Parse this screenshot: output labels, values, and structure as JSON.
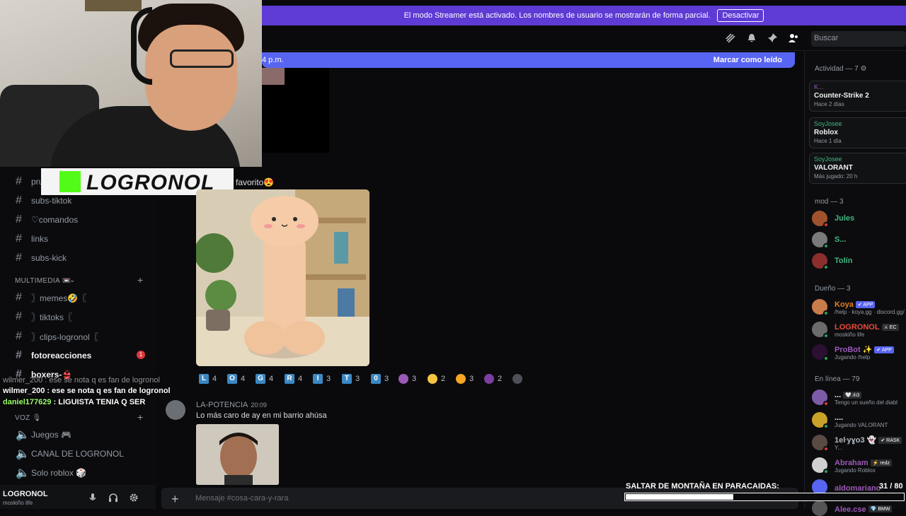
{
  "streamer_banner": {
    "message": "El modo Streamer está activado. Los nombres de usuario se mostrarán de forma parcial.",
    "button": "Desactivar"
  },
  "header": {
    "search_placeholder": "Buscar"
  },
  "new_messages_bar": {
    "time": "4 p.m.",
    "mark_read": "Marcar como leído"
  },
  "overlay_logo": {
    "text": "LOGRONOL",
    "color": "#53fc18"
  },
  "sidebar": {
    "channels_top": [
      {
        "label": "pru"
      },
      {
        "label": "subs-tiktok"
      },
      {
        "label": "♡comandos"
      },
      {
        "label": "links"
      },
      {
        "label": "subs-kick"
      }
    ],
    "category_multimedia": "MULTIMEDIA 📼",
    "multimedia_channels": [
      {
        "label": "〗memes🤣〖"
      },
      {
        "label": "〗tiktoks〖"
      },
      {
        "label": "〗clips-logronol〖"
      },
      {
        "label": "fotoreacciones",
        "badge": "1"
      },
      {
        "label": "boxers-👙"
      }
    ],
    "category_voice": "VOZ 🎙",
    "voice_channels": [
      {
        "label": "Juegos 🎮"
      },
      {
        "label": "CANAL DE LOGRONOL"
      },
      {
        "label": "Solo roblox 🎲"
      }
    ]
  },
  "chat_overlay": [
    {
      "user": "wilmer_200",
      "text": "ese se nota q es fan de logronol",
      "user_color": "#ffffff"
    },
    {
      "user": "daniel177629",
      "text": "LIGUISTA TENIA Q SER",
      "user_color": "#9bff6a"
    }
  ],
  "user_panel": {
    "name": "LOGRONOL",
    "status": "moskiño life"
  },
  "messages": {
    "first_text": "favorito😍",
    "reactions": [
      {
        "type": "tile",
        "label": "L",
        "count": "4"
      },
      {
        "type": "tile",
        "label": "O",
        "count": "4"
      },
      {
        "type": "tile",
        "label": "G",
        "count": "4"
      },
      {
        "type": "tile",
        "label": "R",
        "count": "4"
      },
      {
        "type": "tile",
        "label": "I",
        "count": "3"
      },
      {
        "type": "tile",
        "label": "T",
        "count": "3"
      },
      {
        "type": "tile",
        "label": "0",
        "count": "3"
      },
      {
        "type": "emoji",
        "icon": "imp-face",
        "color": "#9b59b6",
        "count": "3"
      },
      {
        "type": "emoji",
        "icon": "clap",
        "color": "#f5c542",
        "count": "2"
      },
      {
        "type": "emoji",
        "icon": "heart-eyes",
        "color": "#f5a623",
        "count": "3"
      },
      {
        "type": "emoji",
        "icon": "eggplant",
        "color": "#7b3fa0",
        "count": "2"
      }
    ],
    "second": {
      "author": "LA-POTENCIA",
      "timestamp": "20:09",
      "text": "Lo más caro de ay en mi barrio ahúsa"
    }
  },
  "composer": {
    "placeholder": "Mensaje #cosa-cara-y-rara"
  },
  "stream_goal": {
    "label": "SALTAR DE MONTAÑA EN PARACAIDAS:",
    "count": "31 / 80",
    "progress": 0.3875
  },
  "members": {
    "activity_header": "Actividad — 7 ⚙",
    "activities": [
      {
        "user": "K...",
        "game": "Counter-Strike 2",
        "since": "Hace 2 días"
      },
      {
        "user": "SoyJosee",
        "game": "Roblox",
        "since": "Hace 1 día"
      },
      {
        "user": "SoyJosee",
        "game": "VALORANT",
        "since": "Más jugado: 20 h"
      }
    ],
    "mod_header": "mod — 3",
    "mods": [
      {
        "name": "Jules",
        "color": "#43b581"
      },
      {
        "name": "S...",
        "color": "#43b581"
      },
      {
        "name": "Tolín",
        "color": "#43b581"
      }
    ],
    "owner_header": "Dueño — 3",
    "owners": [
      {
        "name": "Koya",
        "tag": "✔ APP",
        "sub": "/help · koya.gg · discord.gg/",
        "color": "#e67e22"
      },
      {
        "name": "LOGRONOL",
        "tag": "⚔ EC",
        "sub": "moskiño life",
        "color": "#e74c3c"
      },
      {
        "name": "ProBot ✨",
        "tag": "✔ APP",
        "sub": "Jugando /help",
        "color": "#9b59b6"
      }
    ],
    "online_header": "En línea — 79",
    "online": [
      {
        "name": "...",
        "tag": "🤍.ılı3",
        "sub": "Tengo un sueño del diabl",
        "color": "#f2f3f5"
      },
      {
        "name": "....",
        "tag": "",
        "sub": "Jugando VALORANT",
        "color": "#f2f3f5"
      },
      {
        "name": "1eŀyɣo3 👻",
        "tag": "✔ RASK",
        "sub": "Y...",
        "color": "#b5bac1"
      },
      {
        "name": "Abraham",
        "tag": "⚡ redz",
        "sub": "Jugando Roblox",
        "color": "#9b59b6"
      },
      {
        "name": "aldomariano",
        "tag": "",
        "sub": "",
        "color": "#9b59b6"
      },
      {
        "name": "Alee.cse",
        "tag": "💎 BMW",
        "sub": "",
        "color": "#9b59b6"
      }
    ]
  }
}
